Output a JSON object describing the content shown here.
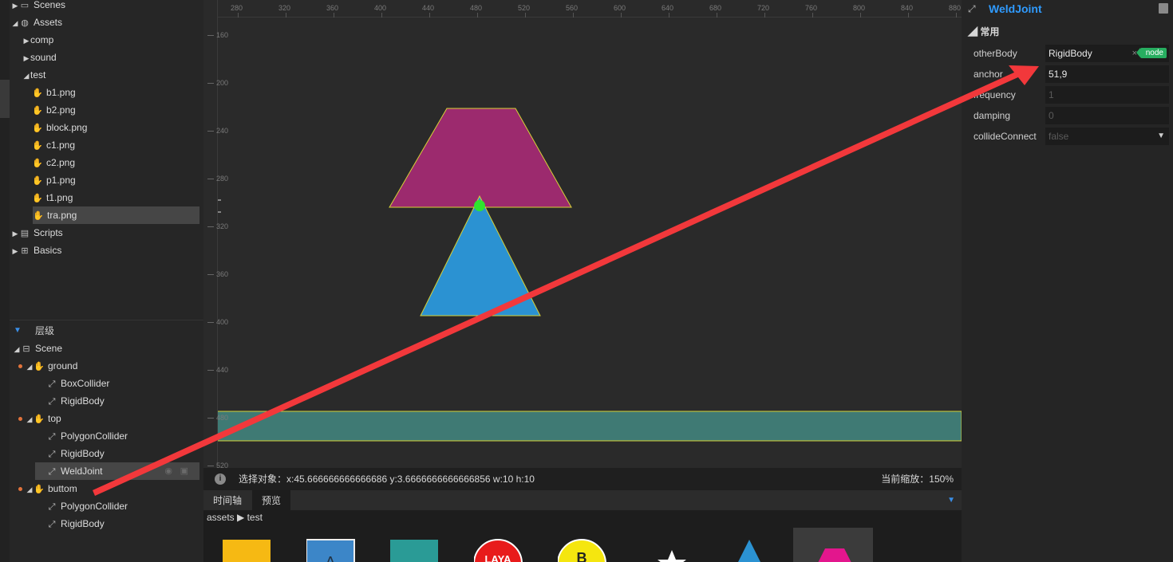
{
  "assets_tree": [
    {
      "label": "Scenes",
      "arrow": "▶",
      "icon": "folder-icon"
    },
    {
      "label": "Assets",
      "arrow": "◢",
      "icon": "globe-icon"
    },
    {
      "label": "comp",
      "arrow": "▶",
      "icon": ""
    },
    {
      "label": "sound",
      "arrow": "▶",
      "icon": ""
    },
    {
      "label": "test",
      "arrow": "◢",
      "icon": ""
    },
    {
      "label": "b1.png",
      "icon": "image-icon"
    },
    {
      "label": "b2.png",
      "icon": "image-icon"
    },
    {
      "label": "block.png",
      "icon": "image-icon"
    },
    {
      "label": "c1.png",
      "icon": "image-icon"
    },
    {
      "label": "c2.png",
      "icon": "image-icon"
    },
    {
      "label": "p1.png",
      "icon": "image-icon"
    },
    {
      "label": "t1.png",
      "icon": "image-icon"
    },
    {
      "label": "tra.png",
      "icon": "image-icon",
      "selected": true
    },
    {
      "label": "Scripts",
      "arrow": "▶",
      "icon": "script-icon"
    },
    {
      "label": "Basics",
      "arrow": "▶",
      "icon": "grid-icon"
    }
  ],
  "hierarchy": {
    "title": "层级",
    "items": [
      {
        "label": "Scene",
        "arrow": "◢",
        "icon": "scene-icon"
      },
      {
        "label": "ground",
        "arrow": "◢",
        "icon": "sprite-icon",
        "dot": true
      },
      {
        "label": "BoxCollider",
        "icon": "component-icon"
      },
      {
        "label": "RigidBody",
        "icon": "component-icon"
      },
      {
        "label": "top",
        "arrow": "◢",
        "icon": "sprite-icon",
        "dot": true
      },
      {
        "label": "PolygonCollider",
        "icon": "component-icon"
      },
      {
        "label": "RigidBody",
        "icon": "component-icon"
      },
      {
        "label": "WeldJoint",
        "icon": "component-icon",
        "selected": true
      },
      {
        "label": "buttom",
        "arrow": "◢",
        "icon": "sprite-icon",
        "dot": true
      },
      {
        "label": "PolygonCollider",
        "icon": "component-icon"
      },
      {
        "label": "RigidBody",
        "icon": "component-icon"
      }
    ]
  },
  "ruler": {
    "top": [
      "280",
      "320",
      "360",
      "400",
      "440",
      "480",
      "520",
      "560",
      "600",
      "640",
      "680",
      "720",
      "760",
      "800",
      "840",
      "880"
    ],
    "left": [
      "160",
      "200",
      "240",
      "280",
      "320",
      "360",
      "400",
      "440",
      "480",
      "520"
    ]
  },
  "scene_colors": {
    "trapezoid": "#9c2a6e",
    "triangle": "#2b92d2",
    "ground": "#3f7a74",
    "outline": "#d7d236",
    "anchor": "#2ee52e",
    "arrow": "#f2383b"
  },
  "status": {
    "selection": "选择对象：x:45.666666666666686 y:3.6666666666666856  w:10 h:10",
    "zoom": "当前缩放：150%"
  },
  "bottom_tabs": [
    "时间轴",
    "预览"
  ],
  "assets_path": "assets ▶ test",
  "assets_thumbs": [
    {
      "kind": "yellow-square",
      "color": "#f6b913"
    },
    {
      "kind": "blue-square-a",
      "color": "#3c86c8",
      "text": "A"
    },
    {
      "kind": "teal-square",
      "color": "#2a9b96"
    },
    {
      "kind": "red-circle-logo",
      "color": "#e81b1b",
      "text": "LAYA"
    },
    {
      "kind": "yellow-circle-b",
      "color": "#f5e60f",
      "text": "B"
    },
    {
      "kind": "white-star",
      "color": "#ffffff"
    },
    {
      "kind": "blue-triangle",
      "color": "#2b92d2"
    },
    {
      "kind": "pink-hexagon",
      "color": "#e3168d"
    }
  ],
  "inspector": {
    "title": "WeldJoint",
    "group": "常用",
    "props": [
      {
        "label": "otherBody",
        "value": "RigidBody",
        "badge": "node",
        "clear": "×"
      },
      {
        "label": "anchor",
        "value": "51,9"
      },
      {
        "label": "frequency",
        "value": "1",
        "dim": true
      },
      {
        "label": "damping",
        "value": "0",
        "dim": true
      },
      {
        "label": "collideConnect",
        "value": "false",
        "dim": true,
        "dropdown": "▼"
      }
    ]
  }
}
